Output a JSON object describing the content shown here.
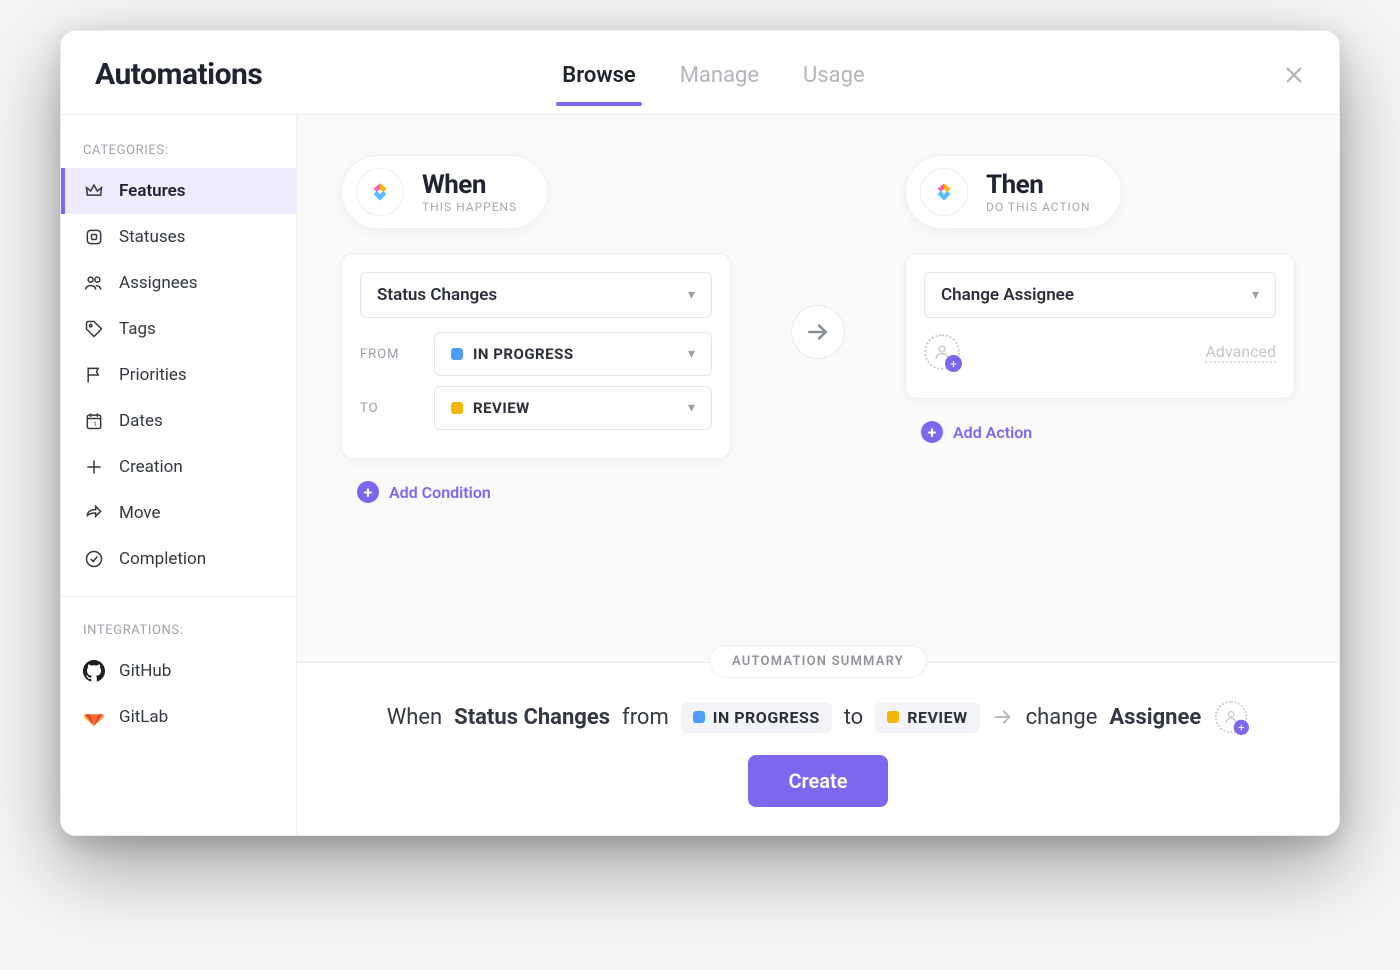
{
  "header": {
    "title": "Automations",
    "tabs": {
      "browse": "Browse",
      "manage": "Manage",
      "usage": "Usage"
    }
  },
  "sidebar": {
    "categories_label": "CATEGORIES:",
    "items": [
      {
        "label": "Features"
      },
      {
        "label": "Statuses"
      },
      {
        "label": "Assignees"
      },
      {
        "label": "Tags"
      },
      {
        "label": "Priorities"
      },
      {
        "label": "Dates"
      },
      {
        "label": "Creation"
      },
      {
        "label": "Move"
      },
      {
        "label": "Completion"
      }
    ],
    "integrations_label": "INTEGRATIONS:",
    "integrations": [
      {
        "label": "GitHub"
      },
      {
        "label": "GitLab"
      }
    ]
  },
  "builder": {
    "when": {
      "title": "When",
      "subtitle": "THIS HAPPENS",
      "trigger": "Status Changes",
      "from_label": "FROM",
      "to_label": "TO",
      "from_status": {
        "name": "IN PROGRESS",
        "color": "#4f9cf9"
      },
      "to_status": {
        "name": "REVIEW",
        "color": "#f0b800"
      },
      "add_condition": "Add Condition"
    },
    "then": {
      "title": "Then",
      "subtitle": "DO THIS ACTION",
      "action": "Change Assignee",
      "advanced": "Advanced",
      "add_action": "Add Action"
    }
  },
  "summary": {
    "badge": "AUTOMATION SUMMARY",
    "when_word": "When",
    "trigger": "Status Changes",
    "from_word": "from",
    "to_word": "to",
    "from_status": {
      "name": "IN PROGRESS",
      "color": "#4f9cf9"
    },
    "to_status": {
      "name": "REVIEW",
      "color": "#f0b800"
    },
    "change_word": "change",
    "action_word": "Assignee",
    "create": "Create"
  }
}
